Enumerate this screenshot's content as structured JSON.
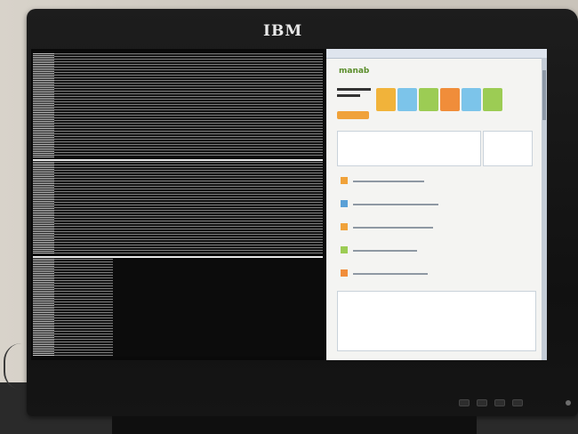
{
  "monitor": {
    "brand": "IBM"
  },
  "browser": {
    "brand": "manab"
  },
  "icons": {
    "power": "power-icon"
  }
}
